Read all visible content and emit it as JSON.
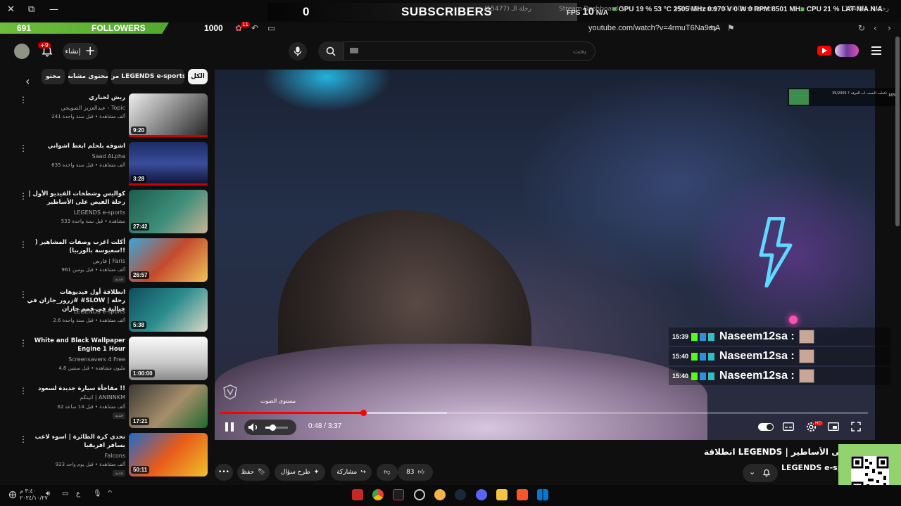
{
  "overlay": {
    "subscribers_count": "0",
    "subscribers_label": "SUBSCRIBERS",
    "ghost_left": "(15477) رحلة الـ",
    "ghost_mid": "Stream Dashboard",
    "ghost_right": "VRKA Stream - Kick Dashboard",
    "ghost_far": "(15476) رحلة الـ",
    "followers_count": "691",
    "followers_label": "FOLLOWERS",
    "followers_goal": "1000",
    "stats": {
      "fps_label": "FPS",
      "fps_value": "10",
      "fps_na": "N/A",
      "gpu_label": "GPU",
      "gpu_pct": "19",
      "gpu_temp": "53",
      "gpu_mhz": "2505",
      "gpu_volt": "0.970",
      "gpu_w": "0",
      "gpu_rpm": "0",
      "mem_mhz": "8501",
      "cpu_label": "CPU",
      "cpu_pct": "21",
      "lat_label": "LAT",
      "lat_na": "N/A",
      "na2": "N/A"
    }
  },
  "browser": {
    "address": "youtube.com/watch?v=4rmuT6Na9mA",
    "tab_badge": "11"
  },
  "header": {
    "notifications_badge": "+9",
    "create_label": "إنشاء",
    "search_placeholder": "بحث"
  },
  "chips": [
    {
      "label": "الكل",
      "active": true
    },
    {
      "label": "من LEGENDS e-sports",
      "active": false
    },
    {
      "label": "محتوى مشابه",
      "active": false
    },
    {
      "label": "محتو",
      "active": false
    }
  ],
  "recommendations": [
    {
      "title": "ريش لحباري",
      "channel": "عبدالعزيز الضويحي - Topic",
      "meta": "241 ألف مشاهدة • قبل سنة واحدة",
      "duration": "9:20",
      "new": ""
    },
    {
      "title": "اشوفه بلحلم ابغط اشواني",
      "channel": "Saad ALpha",
      "meta": "635 ألف مشاهدة • قبل سنة واحدة",
      "duration": "3:28",
      "new": ""
    },
    {
      "title": "كواليس وشطحات الفيديو الأول | رحلة الفيص على الأساطير",
      "channel": "LEGENDS e-sports",
      "meta": "533 مشاهدة • قبل سنة واحدة",
      "duration": "27:42",
      "new": ""
    },
    {
      "title": "أكلت اغرب وصفات المشاهير ( سعيوسة بالوربيا)!!",
      "channel": "فارس | Faris",
      "meta": "961 ألف مشاهدة • قبل يومين",
      "duration": "26:57",
      "new": "جديد"
    },
    {
      "title": "انطلاقة أول فيديوهات #زرور_جازان في #SLOW | رحلة خيالية في قمم جازان",
      "channel": "LEGENDS e-sports",
      "meta": "2.6 ألف مشاهدة • قبل سنة واحدة",
      "duration": "5:38",
      "new": ""
    },
    {
      "title": "White and Black Wallpaper Engine 1 Hour",
      "channel": "Screensavers 4 Free",
      "meta": "4.8 مليون مشاهدة • قبل سنتين",
      "duration": "1:00:00",
      "new": ""
    },
    {
      "title": "مفاجأة سيارة جديدة لسعود !!",
      "channel": "انينكم | ANINNKM",
      "meta": "62 ألف مشاهدة • قبل 14 ساعة",
      "duration": "17:21",
      "new": "جديد"
    },
    {
      "title": "تحدي كرة الطائرة | اسوء لاعب يسافر افريقيا",
      "channel": "Falcons",
      "meta": "923 ألف مشاهدة • قبل يوم واحد",
      "duration": "50:11",
      "new": "جديد"
    }
  ],
  "player": {
    "current_time": "0:48",
    "duration": "3:37",
    "progress_fraction": 0.221,
    "buffered_fraction": 0.35,
    "volume_fraction": 0.3,
    "volume_tooltip": "مستوى الصوت",
    "hd_badge": "HD"
  },
  "chat": [
    {
      "time": "15:39",
      "name": "Naseem12sa :"
    },
    {
      "time": "15:40",
      "name": "Naseem12sa :"
    },
    {
      "time": "15:40",
      "name": "Naseem12sa :"
    }
  ],
  "alert": {
    "text": "تكملت النسب اب الغرفه ؟ 35/2005",
    "pct": "16%"
  },
  "video_info": {
    "title": "انطلاقة LEGENDS | على الأساطير",
    "channel": "LEGENDS e-sp",
    "likes": "83",
    "share_label": "مشاركة",
    "ask_label": "طرح سؤال",
    "save_label": "حفظ"
  },
  "taskbar": {
    "time": "٣:٤٠ م",
    "date": "٢٠٢٤/١٠/٢٧",
    "lang": "ع"
  },
  "colors": {
    "accent_red": "#ff0000",
    "followers_green": "#6ebd3c",
    "qr_green": "#93d36d"
  }
}
